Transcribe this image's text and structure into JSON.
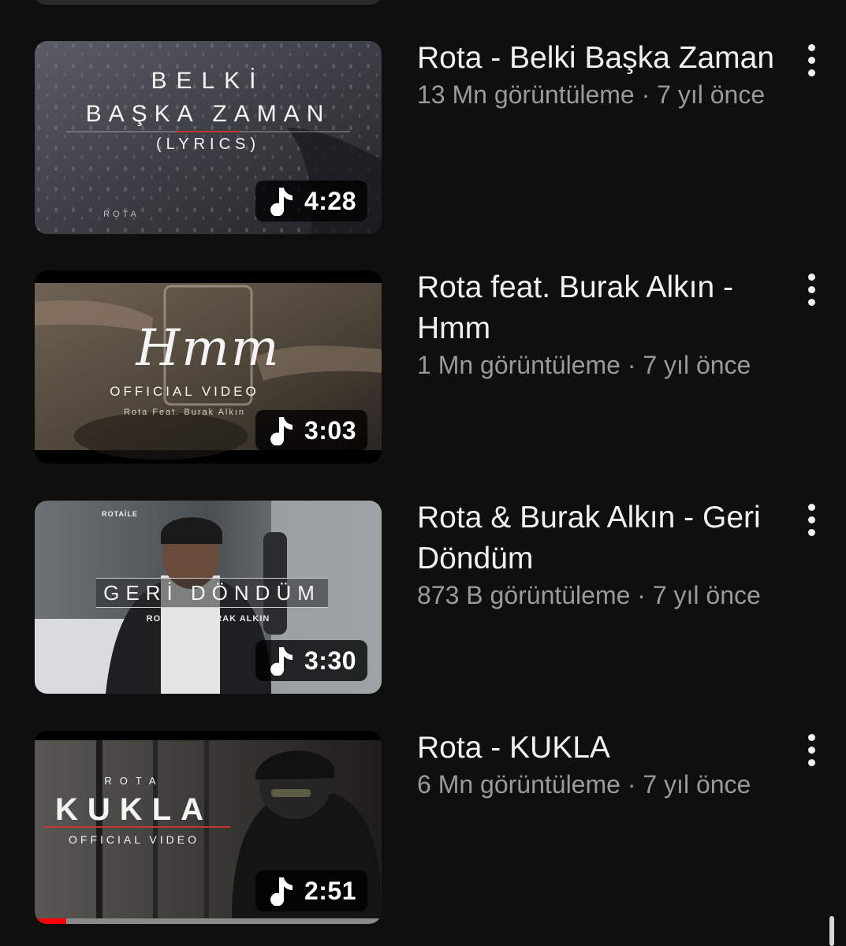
{
  "videos": [
    {
      "title": "Rota - Belki Başka Zaman",
      "views": "13 Mn görüntüleme",
      "age": "7 yıl önce",
      "duration": "4:28",
      "thumbnail": {
        "line1": "BELKİ",
        "line2": "BAŞKA ZAMAN",
        "line3": "(LYRICS)",
        "line4": "ROTA"
      }
    },
    {
      "title": "Rota feat. Burak Alkın - Hmm",
      "views": "1 Mn görüntüleme",
      "age": "7 yıl önce",
      "duration": "3:03",
      "thumbnail": {
        "line1": "Hmm",
        "line2": "OFFICIAL VIDEO",
        "line3": "Rota Feat. Burak Alkın"
      }
    },
    {
      "title": "Rota & Burak Alkın - Geri Döndüm",
      "views": "873 B görüntüleme",
      "age": "7 yıl önce",
      "duration": "3:30",
      "thumbnail": {
        "line1": "GERİ DÖNDÜM",
        "line2": "ROTA feat. BURAK ALKIN",
        "cap_text": "ROTAİLE"
      }
    },
    {
      "title": "Rota - KUKLA",
      "views": "6 Mn görüntüleme",
      "age": "7 yıl önce",
      "duration": "2:51",
      "watch_progress": 0.09,
      "thumbnail": {
        "line1": "ROTA",
        "line2": "KUKLA",
        "line3": "OFFICIAL VIDEO"
      }
    }
  ],
  "meta_separator": " · ",
  "icons": {
    "duration": "music-note-icon",
    "menu": "more-vertical-icon"
  },
  "colors": {
    "background": "#0f0f0f",
    "title": "#f1f1f1",
    "meta": "#9a9a9a",
    "progress": "#ff0000"
  }
}
